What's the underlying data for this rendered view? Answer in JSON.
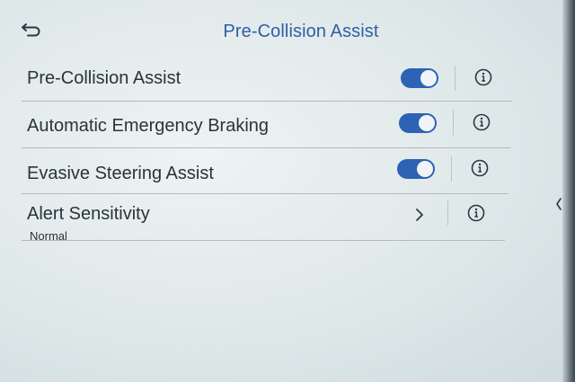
{
  "header": {
    "title": "Pre-Collision Assist",
    "back_icon": "back-arrow-icon"
  },
  "settings": [
    {
      "label": "Pre-Collision Assist",
      "control": "toggle",
      "enabled": true,
      "info_icon": "info-icon"
    },
    {
      "label": "Automatic Emergency Braking",
      "control": "toggle",
      "enabled": true,
      "info_icon": "info-icon"
    },
    {
      "label": "Evasive Steering Assist",
      "control": "toggle",
      "enabled": true,
      "info_icon": "info-icon"
    },
    {
      "label": "Alert Sensitivity",
      "value": "Normal",
      "control": "chevron",
      "chevron_icon": "chevron-right-icon",
      "info_icon": "info-icon"
    }
  ],
  "side_control": {
    "icon": "chevron-left-icon"
  },
  "colors": {
    "accent": "#2e62b5",
    "title": "#2d5fa6",
    "text": "#28343b"
  }
}
